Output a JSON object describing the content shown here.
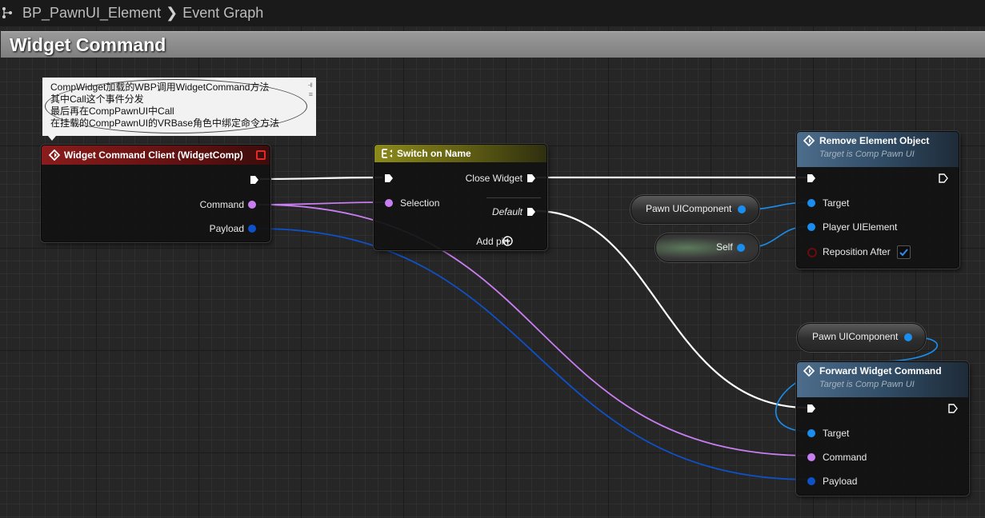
{
  "breadcrumb": {
    "blueprint": "BP_PawnUI_Element",
    "graph": "Event Graph"
  },
  "comment_box": {
    "title": "Widget Command"
  },
  "note": {
    "lines": [
      "CompWidget加载的WBP调用WidgetCommand方法",
      "其中Call这个事件分发",
      "最后再在CompPawnUI中Call",
      "在挂载的CompPawnUI的VRBase角色中绑定命令方法"
    ]
  },
  "event_node": {
    "title": "Widget Command Client (WidgetComp)",
    "command_label": "Command",
    "payload_label": "Payload",
    "header_color": "#7a1a1a"
  },
  "switch_node": {
    "title": "Switch on Name",
    "selection_label": "Selection",
    "case_label": "Close Widget",
    "default_label": "Default",
    "add_pin_label": "Add pin",
    "header_color": "#6c6a14"
  },
  "remove_node": {
    "title": "Remove Element Object",
    "subtitle": "Target is Comp Pawn UI",
    "target_label": "Target",
    "element_label": "Player UIElement",
    "reposition_label": "Reposition After",
    "reposition_checked": true,
    "header_color": "#3f5b75"
  },
  "forward_node": {
    "title": "Forward Widget Command",
    "subtitle": "Target is Comp Pawn UI",
    "target_label": "Target",
    "command_label": "Command",
    "payload_label": "Payload",
    "header_color": "#3f5b75"
  },
  "var_pawn_ui_1": {
    "label": "Pawn UIComponent"
  },
  "var_self": {
    "label": "Self"
  },
  "var_pawn_ui_2": {
    "label": "Pawn UIComponent"
  },
  "colors": {
    "exec_wire": "#ffffff",
    "name_pin": "#c77ef0",
    "object_pin": "#1a8ef0",
    "struct_pin": "#0e51c9",
    "checkbox_tick": "#2d8cf0"
  }
}
